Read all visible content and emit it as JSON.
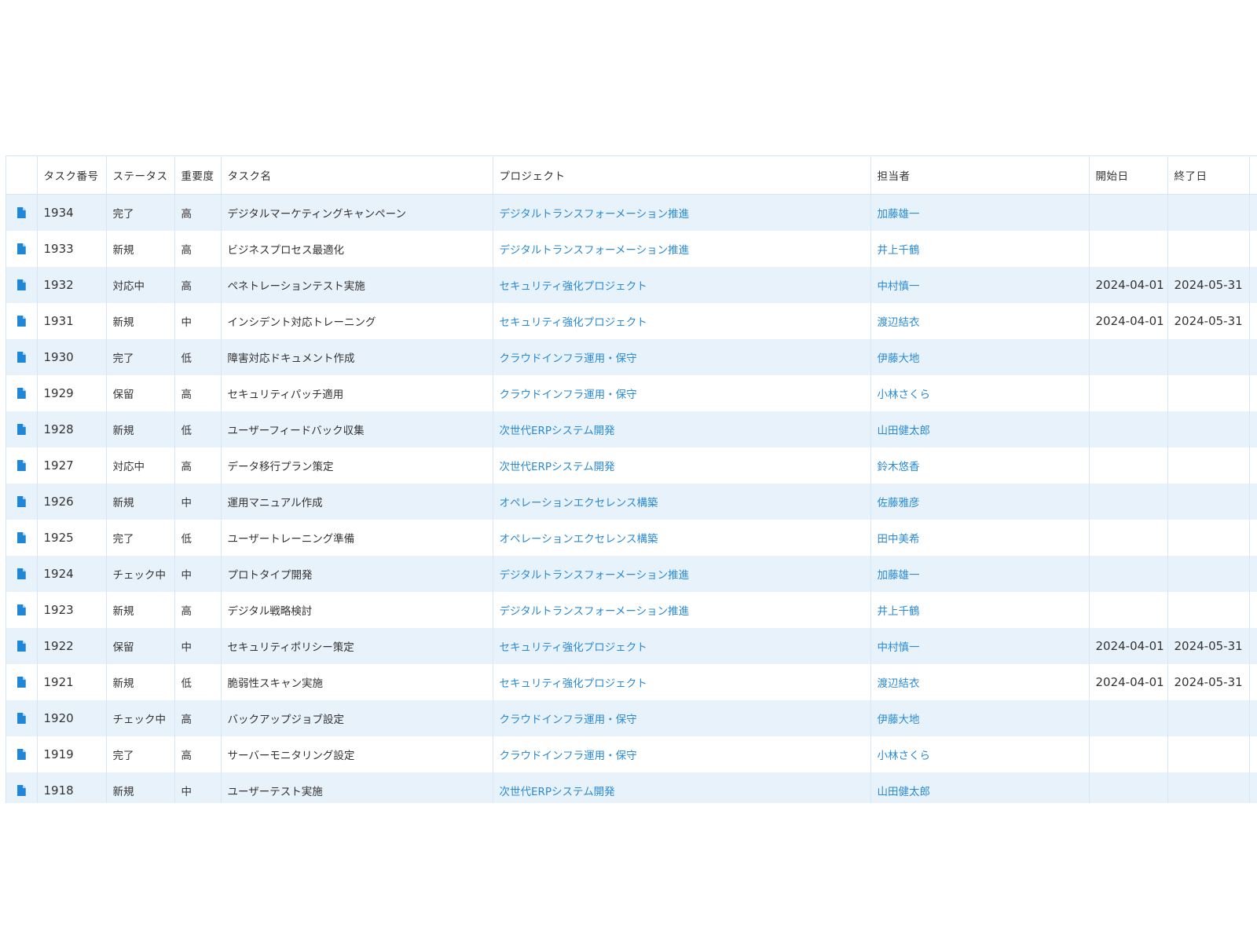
{
  "columns": [
    "",
    "タスク番号",
    "ステータス",
    "重要度",
    "タスク名",
    "プロジェクト",
    "担当者",
    "開始日",
    "終了日",
    ""
  ],
  "rows": [
    {
      "id": "1934",
      "status": "完了",
      "priority": "高",
      "task": "デジタルマーケティングキャンペーン",
      "project": "デジタルトランスフォーメーション推進",
      "assignee": "加藤雄一",
      "start": "",
      "end": ""
    },
    {
      "id": "1933",
      "status": "新規",
      "priority": "高",
      "task": "ビジネスプロセス最適化",
      "project": "デジタルトランスフォーメーション推進",
      "assignee": "井上千鶴",
      "start": "",
      "end": ""
    },
    {
      "id": "1932",
      "status": "対応中",
      "priority": "高",
      "task": "ペネトレーションテスト実施",
      "project": "セキュリティ強化プロジェクト",
      "assignee": "中村慎一",
      "start": "2024-04-01",
      "end": "2024-05-31"
    },
    {
      "id": "1931",
      "status": "新規",
      "priority": "中",
      "task": "インシデント対応トレーニング",
      "project": "セキュリティ強化プロジェクト",
      "assignee": "渡辺結衣",
      "start": "2024-04-01",
      "end": "2024-05-31"
    },
    {
      "id": "1930",
      "status": "完了",
      "priority": "低",
      "task": "障害対応ドキュメント作成",
      "project": "クラウドインフラ運用・保守",
      "assignee": "伊藤大地",
      "start": "",
      "end": ""
    },
    {
      "id": "1929",
      "status": "保留",
      "priority": "高",
      "task": "セキュリティパッチ適用",
      "project": "クラウドインフラ運用・保守",
      "assignee": "小林さくら",
      "start": "",
      "end": ""
    },
    {
      "id": "1928",
      "status": "新規",
      "priority": "低",
      "task": "ユーザーフィードバック収集",
      "project": "次世代ERPシステム開発",
      "assignee": "山田健太郎",
      "start": "",
      "end": ""
    },
    {
      "id": "1927",
      "status": "対応中",
      "priority": "高",
      "task": "データ移行プラン策定",
      "project": "次世代ERPシステム開発",
      "assignee": "鈴木悠香",
      "start": "",
      "end": ""
    },
    {
      "id": "1926",
      "status": "新規",
      "priority": "中",
      "task": "運用マニュアル作成",
      "project": "オペレーションエクセレンス構築",
      "assignee": "佐藤雅彦",
      "start": "",
      "end": ""
    },
    {
      "id": "1925",
      "status": "完了",
      "priority": "低",
      "task": "ユーザートレーニング準備",
      "project": "オペレーションエクセレンス構築",
      "assignee": "田中美希",
      "start": "",
      "end": ""
    },
    {
      "id": "1924",
      "status": "チェック中",
      "priority": "中",
      "task": "プロトタイプ開発",
      "project": "デジタルトランスフォーメーション推進",
      "assignee": "加藤雄一",
      "start": "",
      "end": ""
    },
    {
      "id": "1923",
      "status": "新規",
      "priority": "高",
      "task": "デジタル戦略検討",
      "project": "デジタルトランスフォーメーション推進",
      "assignee": "井上千鶴",
      "start": "",
      "end": ""
    },
    {
      "id": "1922",
      "status": "保留",
      "priority": "中",
      "task": "セキュリティポリシー策定",
      "project": "セキュリティ強化プロジェクト",
      "assignee": "中村慎一",
      "start": "2024-04-01",
      "end": "2024-05-31"
    },
    {
      "id": "1921",
      "status": "新規",
      "priority": "低",
      "task": "脆弱性スキャン実施",
      "project": "セキュリティ強化プロジェクト",
      "assignee": "渡辺結衣",
      "start": "2024-04-01",
      "end": "2024-05-31"
    },
    {
      "id": "1920",
      "status": "チェック中",
      "priority": "高",
      "task": "バックアップジョブ設定",
      "project": "クラウドインフラ運用・保守",
      "assignee": "伊藤大地",
      "start": "",
      "end": ""
    },
    {
      "id": "1919",
      "status": "完了",
      "priority": "高",
      "task": "サーバーモニタリング設定",
      "project": "クラウドインフラ運用・保守",
      "assignee": "小林さくら",
      "start": "",
      "end": ""
    },
    {
      "id": "1918",
      "status": "新規",
      "priority": "中",
      "task": "ユーザーテスト実施",
      "project": "次世代ERPシステム開発",
      "assignee": "山田健太郎",
      "start": "",
      "end": ""
    }
  ],
  "icon": "document-icon",
  "colors": {
    "link": "#2a8ad3",
    "row_alt": "#e8f2fb",
    "border": "#d6e6f3",
    "icon": "#1f87d6"
  }
}
